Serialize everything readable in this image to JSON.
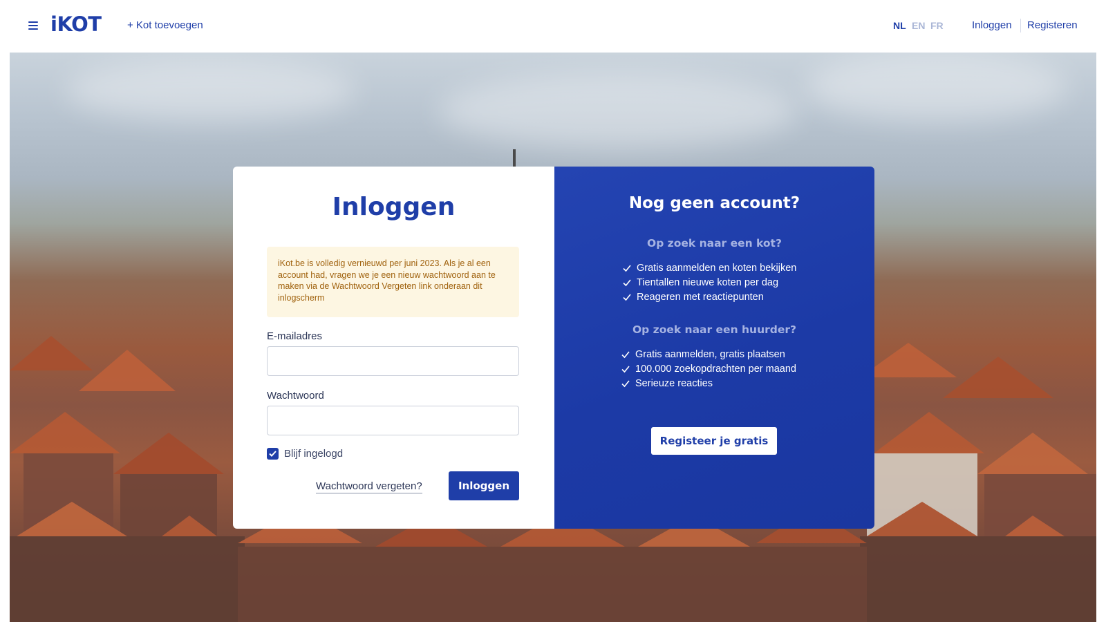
{
  "header": {
    "logo": "iKOT",
    "add_kot": "+ Kot toevoegen",
    "languages": [
      "NL",
      "EN",
      "FR"
    ],
    "active_language": "NL",
    "login_link": "Inloggen",
    "register_link": "Registeren"
  },
  "login": {
    "title": "Inloggen",
    "notice": "iKot.be is volledig vernieuwd per juni 2023. Als je al een account had, vragen we je een nieuw wachtwoord aan te maken via de Wachtwoord Vergeten link onderaan dit inlogscherm",
    "email_label": "E-mailadres",
    "email_value": "",
    "password_label": "Wachtwoord",
    "password_value": "",
    "remember_label": "Blijf ingelogd",
    "remember_checked": true,
    "forgot_link": "Wachtwoord vergeten?",
    "submit_label": "Inloggen"
  },
  "register": {
    "title": "Nog geen account?",
    "tenant_heading": "Op zoek naar een kot?",
    "tenant_items": [
      "Gratis aanmelden en koten bekijken",
      "Tientallen nieuwe koten per dag",
      "Reageren met reactiepunten"
    ],
    "landlord_heading": "Op zoek naar een huurder?",
    "landlord_items": [
      "Gratis aanmelden, gratis plaatsen",
      "100.000 zoekopdrachten per maand",
      "Serieuze reacties"
    ],
    "cta_label": "Registeer je gratis"
  },
  "colors": {
    "brand_blue": "#1f3ea8",
    "notice_bg": "#fdf6e2",
    "notice_text": "#a0620e",
    "panel_blue": "#1c3aa6"
  },
  "icons": {
    "menu": "hamburger-icon",
    "check": "check-icon"
  }
}
